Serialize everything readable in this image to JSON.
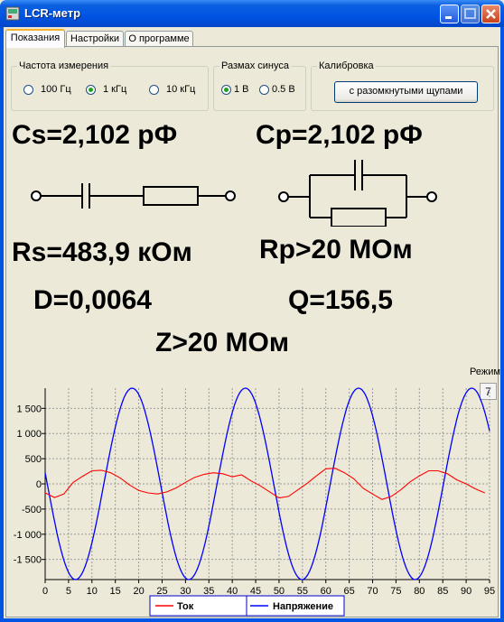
{
  "window": {
    "title": "LCR-метр"
  },
  "tabs": [
    {
      "label": "Показания",
      "active": true
    },
    {
      "label": "Настройки",
      "active": false
    },
    {
      "label": "О программе",
      "active": false
    }
  ],
  "frequency": {
    "title": "Частота измерения",
    "options": [
      {
        "label": "100 Гц",
        "selected": false
      },
      {
        "label": "1 кГц",
        "selected": true
      },
      {
        "label": "10 кГц",
        "selected": false
      }
    ]
  },
  "amplitude": {
    "title": "Размах синуса",
    "options": [
      {
        "label": "1 В",
        "selected": true
      },
      {
        "label": "0.5 В",
        "selected": false
      }
    ]
  },
  "calibration": {
    "title": "Калибровка",
    "button_label": "с разомкнутыми щупами"
  },
  "readings": {
    "cs": "Cs=2,102 рФ",
    "cp": "Cp=2,102 рФ",
    "rs": "Rs=483,9 кОм",
    "rp": "Rp>20 МОм",
    "d": "D=0,0064",
    "q": "Q=156,5",
    "z": "Z>20 МОм"
  },
  "mode": {
    "label": "Режим",
    "value": "7"
  },
  "colors": {
    "current": "#ff0000",
    "voltage": "#0000ff"
  },
  "chart_data": {
    "type": "line",
    "x_range": [
      0,
      95
    ],
    "y_range": [
      -1900,
      1900
    ],
    "x_ticks": [
      "0",
      "5",
      "10",
      "15",
      "20",
      "25",
      "30",
      "35",
      "40",
      "45",
      "50",
      "55",
      "60",
      "65",
      "70",
      "75",
      "80",
      "85",
      "90",
      "95"
    ],
    "y_ticks": [
      "1 500",
      "1 000",
      "500",
      "0",
      "-500",
      "-1 000",
      "-1 500"
    ],
    "y_tick_values": [
      1500,
      1000,
      500,
      0,
      -500,
      -1000,
      -1500
    ],
    "grid": true,
    "legend_position": "bottom",
    "series": [
      {
        "name": "Ток",
        "color": "#ff0000",
        "x": [
          0,
          2,
          4,
          6,
          8,
          10,
          12,
          14,
          16,
          18,
          20,
          22,
          24,
          26,
          28,
          30,
          32,
          34,
          36,
          38,
          40,
          42,
          44,
          46,
          48,
          50,
          52,
          54,
          56,
          58,
          60,
          62,
          64,
          66,
          68,
          70,
          72,
          74,
          76,
          78,
          80,
          82,
          84,
          86,
          88,
          90,
          92,
          94
        ],
        "y": [
          -180,
          -270,
          -200,
          30,
          150,
          260,
          270,
          220,
          120,
          -20,
          -130,
          -180,
          -200,
          -160,
          -80,
          30,
          130,
          190,
          220,
          200,
          140,
          180,
          60,
          -40,
          -160,
          -280,
          -250,
          -120,
          10,
          160,
          300,
          310,
          220,
          100,
          -90,
          -200,
          -310,
          -250,
          -120,
          40,
          160,
          260,
          260,
          200,
          80,
          0,
          -100,
          -180
        ]
      },
      {
        "name": "Напряжение",
        "color": "#0000ff",
        "period": 24.2,
        "amplitude": 1900,
        "phase_x_at_peak": 18.6,
        "x_end": 95
      }
    ]
  }
}
